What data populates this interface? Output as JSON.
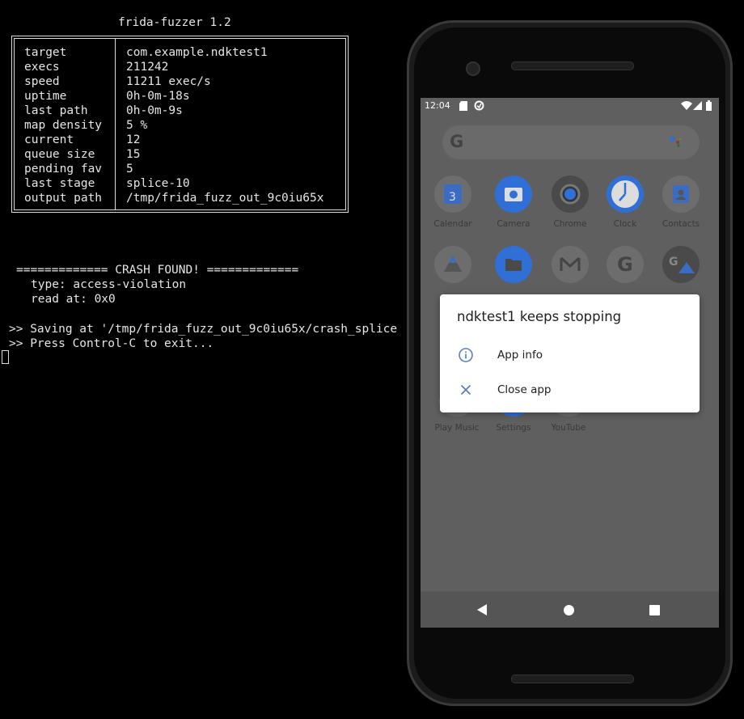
{
  "terminal": {
    "title": "frida-fuzzer 1.2",
    "stats": [
      {
        "key": "target",
        "value": "com.example.ndktest1"
      },
      {
        "key": "execs",
        "value": "211242"
      },
      {
        "key": "speed",
        "value": "11211 exec/s"
      },
      {
        "key": "uptime",
        "value": "0h-0m-18s"
      },
      {
        "key": "last path",
        "value": "0h-0m-9s"
      },
      {
        "key": "map density",
        "value": "5 %"
      },
      {
        "key": "current",
        "value": "12"
      },
      {
        "key": "queue size",
        "value": "15"
      },
      {
        "key": "pending fav",
        "value": "5"
      },
      {
        "key": "last stage",
        "value": "splice-10"
      },
      {
        "key": "output path",
        "value": "/tmp/frida_fuzz_out_9c0iu65x"
      }
    ],
    "crash_header": "============= CRASH FOUND! =============",
    "crash_type": "type: access-violation",
    "crash_read": "read at: 0x0",
    "save_line": ">> Saving at '/tmp/frida_fuzz_out_9c0iu65x/crash_splice",
    "exit_line": ">> Press Control-C to exit..."
  },
  "phone": {
    "status_time": "12:04",
    "search_logo": "G",
    "apps_row1": [
      {
        "label": "Calendar",
        "icon": "calendar-icon",
        "color": "#3b6cc4",
        "glyph": "3"
      },
      {
        "label": "Camera",
        "icon": "camera-icon",
        "color": "#2f6fd6",
        "glyph": ""
      },
      {
        "label": "Chrome",
        "icon": "chrome-icon",
        "color": "#4d4d4d",
        "glyph": ""
      },
      {
        "label": "Clock",
        "icon": "clock-icon",
        "color": "#2f6fd6",
        "glyph": ""
      },
      {
        "label": "Contacts",
        "icon": "contacts-icon",
        "color": "#3b6cc4",
        "glyph": ""
      }
    ],
    "apps_row3": [
      {
        "label": "Play Music",
        "icon": "play-music-icon"
      },
      {
        "label": "Settings",
        "icon": "settings-icon"
      },
      {
        "label": "YouTube",
        "icon": "youtube-icon"
      }
    ],
    "dialog": {
      "title": "ndktest1 keeps stopping",
      "items": [
        {
          "label": "App info",
          "icon": "info-icon"
        },
        {
          "label": "Close app",
          "icon": "close-icon"
        }
      ]
    },
    "accent": "#2f6fd6"
  }
}
